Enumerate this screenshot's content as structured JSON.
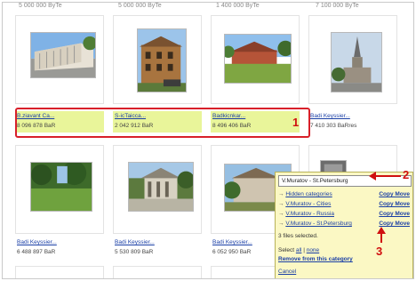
{
  "top_strip": [
    "5 000 000 ByTe",
    "5 000 000 ByTe",
    "1 400 000 ByTe",
    "7 100 000 ByTe"
  ],
  "row1": [
    {
      "name": "B.ziavant Ca...",
      "size": "8 096 878 BaR",
      "selected": true
    },
    {
      "name": "S-icTaicca...",
      "size": "2 042 912 BaR",
      "selected": true
    },
    {
      "name": "Badkicnkar...",
      "size": "8 496 406 BaR",
      "selected": true
    },
    {
      "name": "Badi Keyssier...",
      "size": "7 410 303 BaRres",
      "selected": false
    }
  ],
  "row2": [
    {
      "name": "Badi Keyssier...",
      "size": "6 488 897 BaR"
    },
    {
      "name": "Badi Keyssier...",
      "size": "5 530 809 BaR"
    },
    {
      "name": "Badi Keyssier...",
      "size": "6 052 950 BaR"
    }
  ],
  "callouts": {
    "one": "1",
    "two": "2",
    "three": "3"
  },
  "popup": {
    "input_value": "V.Muratov - St.Petersburg",
    "categories": [
      {
        "arrow": "→",
        "label": "Hidden categories",
        "actions": "Copy Move"
      },
      {
        "arrow": "→",
        "label": "V.Muratov - Cities",
        "actions": "Copy Move"
      },
      {
        "arrow": "→",
        "label": "V.Muratov - Russia",
        "actions": "Copy Move"
      },
      {
        "arrow": "→",
        "label": "V.Muratov - St.Petersburg",
        "actions": "Copy Move"
      }
    ],
    "status": "3 files selected.",
    "select_prefix": "Select ",
    "select_all": "all",
    "select_sep": " | ",
    "select_none": "none",
    "remove_from_category": "Remove from this category",
    "cancel": "Cancel"
  },
  "colors": {
    "highlight": "#e9f59a",
    "callout_red": "#d01010",
    "link": "#1a3fa6",
    "popup_bg": "#fbf8c4"
  }
}
